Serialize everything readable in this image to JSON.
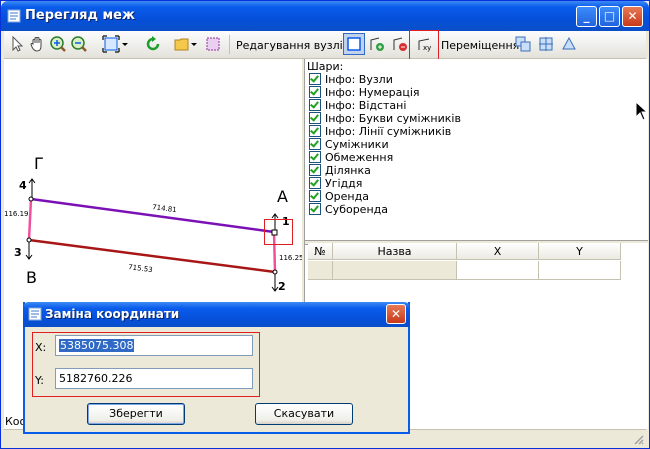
{
  "window": {
    "title": "Перегляд меж",
    "minimize_label": "_",
    "maximize_label": "□",
    "close_label": "✕"
  },
  "toolbar": {
    "edit_nodes_label": "Редагування вузлів:",
    "move_label": "Переміщення:"
  },
  "map": {
    "labels": [
      "Г",
      "А",
      "В"
    ],
    "node_numbers": [
      "4",
      "1",
      "3",
      "2"
    ],
    "distances": [
      "714.81",
      "116.19",
      "715.53",
      "116.25"
    ],
    "colors": {
      "top": "#7B10B5",
      "bottom": "#A81616",
      "side": "#F0509C"
    }
  },
  "status": {
    "text": "Коо"
  },
  "layers": {
    "header": "Шари:",
    "items": [
      "Інфо: Вузли",
      "Інфо: Нумерація",
      "Інфо: Відстані",
      "Інфо: Букви суміжників",
      "Інфо: Лінії суміжників",
      "Суміжники",
      "Обмеження",
      "Ділянка",
      "Угіддя",
      "Оренда",
      "Суборенда"
    ]
  },
  "grid": {
    "columns": [
      "№",
      "Назва",
      "X",
      "Y"
    ]
  },
  "dialog": {
    "title": "Заміна координати",
    "x_label": "X:",
    "x_value": "5385075.308",
    "y_label": "Y:",
    "y_value": "5182760.226",
    "save_label": "Зберегти",
    "cancel_label": "Скасувати",
    "close_label": "✕"
  }
}
